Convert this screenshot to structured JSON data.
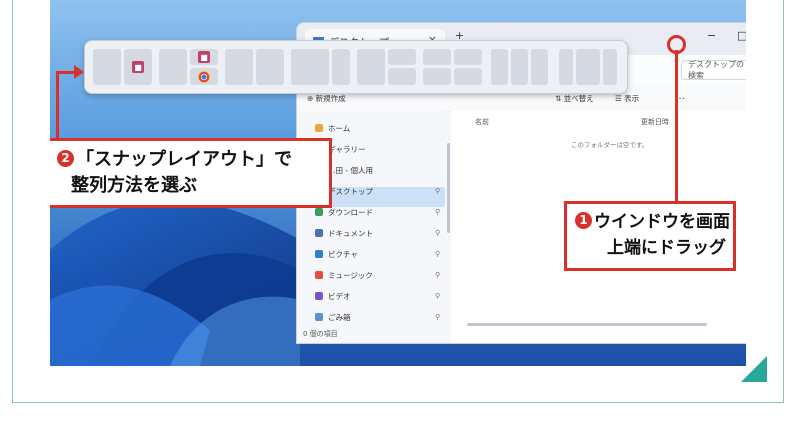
{
  "explorer": {
    "tab_title": "デスクトップ",
    "tab_close": "×",
    "minimize": "−",
    "maximize": "□",
    "search_placeholder": "デスクトップの検索",
    "toolbar": {
      "new_label": "新規作成",
      "sort_label": "並べ替え",
      "view_label": "表示",
      "more_label": "…"
    },
    "nav": [
      {
        "label": "ホーム",
        "pinned": false
      },
      {
        "label": "ギャラリー",
        "pinned": false
      },
      {
        "label": "…田 - 個人用",
        "pinned": false
      },
      {
        "label": "デスクトップ",
        "pinned": true,
        "selected": true
      },
      {
        "label": "ダウンロード",
        "pinned": true
      },
      {
        "label": "ドキュメント",
        "pinned": true
      },
      {
        "label": "ピクチャ",
        "pinned": true
      },
      {
        "label": "ミュージック",
        "pinned": true
      },
      {
        "label": "ビデオ",
        "pinned": true
      },
      {
        "label": "ごみ箱",
        "pinned": true
      }
    ],
    "columns": {
      "name": "名前",
      "date": "更新日時"
    },
    "empty_message": "このフォルダーは空です。",
    "status": "0 個の項目",
    "pin_glyph": "⚲"
  },
  "snap_layouts": {
    "apps": [
      {
        "name": "Teams",
        "icon": "teams-icon"
      },
      {
        "name": "Chrome",
        "icon": "chrome-icon"
      }
    ]
  },
  "callouts": {
    "step1": {
      "number": "1",
      "line1": "ウインドウを画面",
      "line2": "上端にドラッグ"
    },
    "step2": {
      "number": "2",
      "line1": "「スナップレイアウト」で",
      "line2": "整列方法を選ぶ"
    }
  },
  "colors": {
    "accent_red": "#d7312a",
    "frame_teal": "#27a89b",
    "wallpaper_blue": "#3f7fc6"
  }
}
